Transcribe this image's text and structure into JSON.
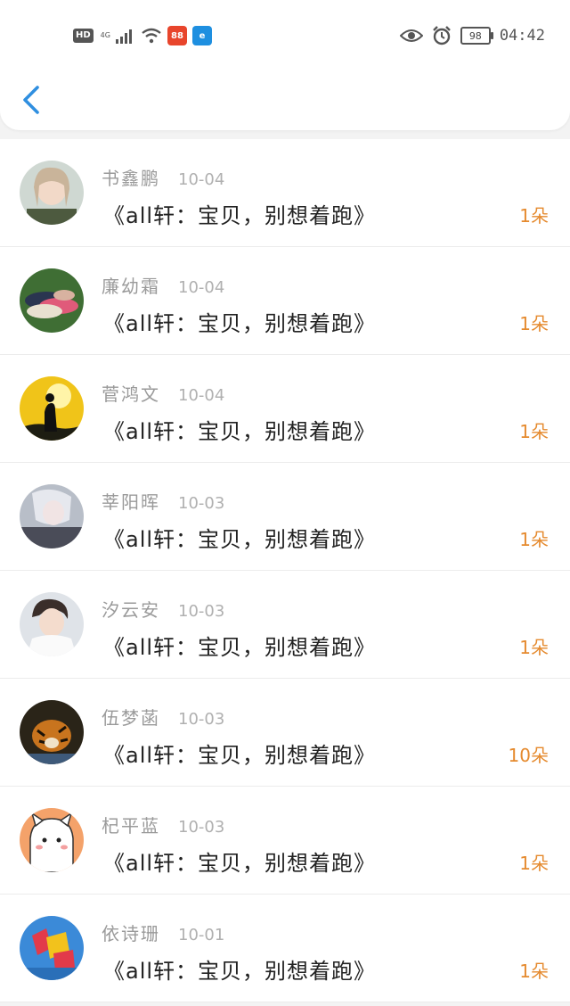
{
  "status_bar": {
    "hd": "HD",
    "network": "4G",
    "app1": "88",
    "app2": "e",
    "battery": "98",
    "time": "04:42",
    "icons": [
      "hd-icon",
      "signal-icon",
      "wifi-icon",
      "app-icon",
      "app-icon",
      "eye-icon",
      "alarm-icon",
      "battery-icon"
    ]
  },
  "colors": {
    "accent": "#2f8fe0",
    "count": "#e58a2e"
  },
  "gifts": [
    {
      "name": "书鑫鹏",
      "date": "10-04",
      "gift": "《all轩：宝贝，别想着跑》",
      "count": "1朵"
    },
    {
      "name": "廉幼霜",
      "date": "10-04",
      "gift": "《all轩：宝贝，别想着跑》",
      "count": "1朵"
    },
    {
      "name": "菅鸿文",
      "date": "10-04",
      "gift": "《all轩：宝贝，别想着跑》",
      "count": "1朵"
    },
    {
      "name": "莘阳晖",
      "date": "10-03",
      "gift": "《all轩：宝贝，别想着跑》",
      "count": "1朵"
    },
    {
      "name": "汐云安",
      "date": "10-03",
      "gift": "《all轩：宝贝，别想着跑》",
      "count": "1朵"
    },
    {
      "name": "伍梦菡",
      "date": "10-03",
      "gift": "《all轩：宝贝，别想着跑》",
      "count": "10朵"
    },
    {
      "name": "杞平蓝",
      "date": "10-03",
      "gift": "《all轩：宝贝，别想着跑》",
      "count": "1朵"
    },
    {
      "name": "依诗珊",
      "date": "10-01",
      "gift": "《all轩：宝贝，别想着跑》",
      "count": "1朵"
    }
  ]
}
